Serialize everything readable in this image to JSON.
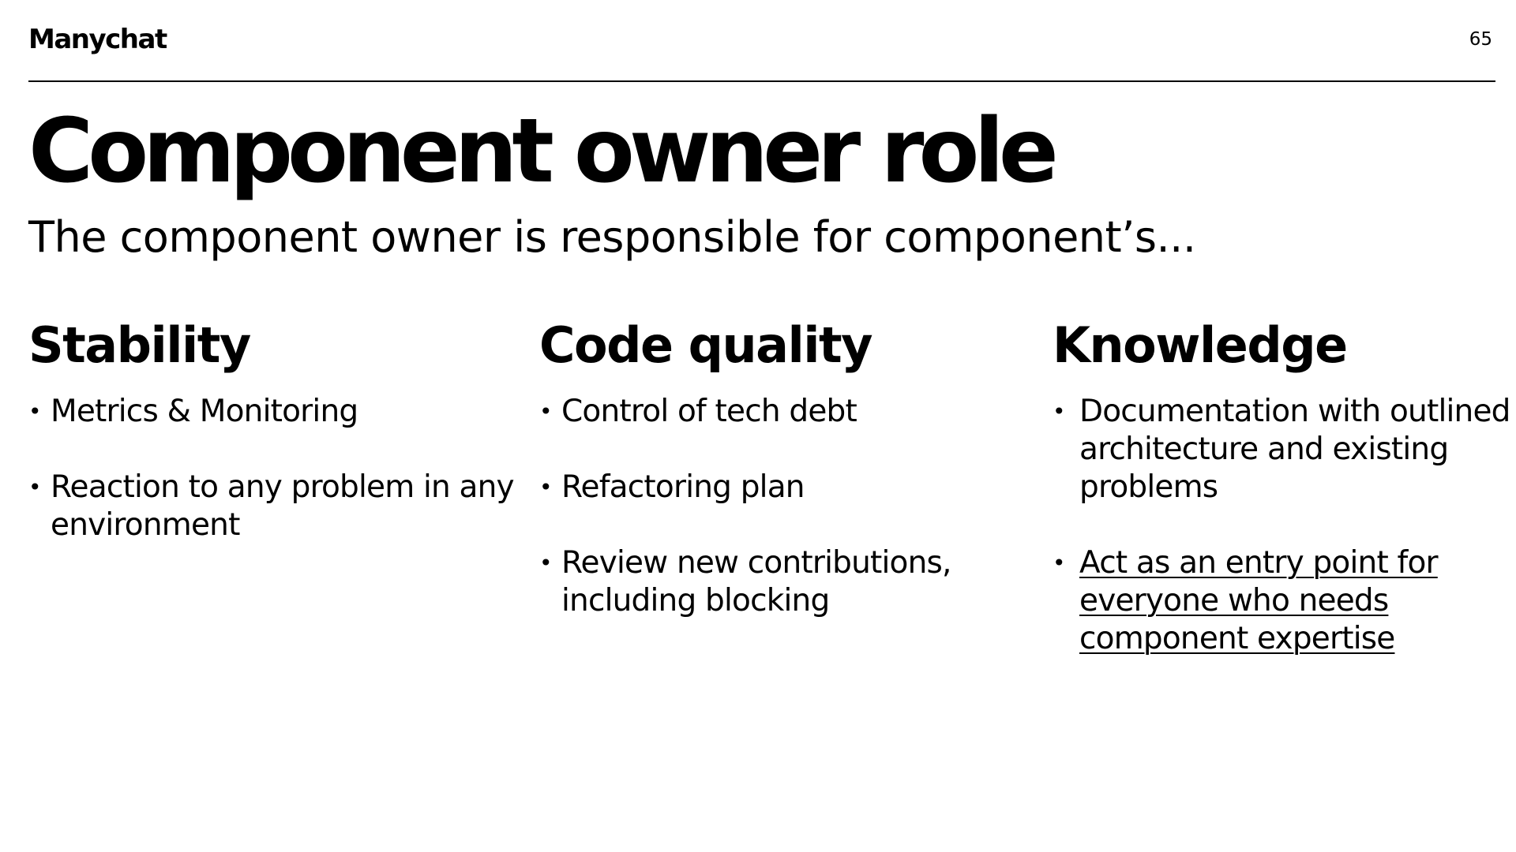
{
  "header": {
    "logo_text": "Manychat",
    "page_number": "65"
  },
  "title": "Component owner role",
  "subtitle": "The component owner is responsible for component’s...",
  "bullet_symbol": "•",
  "columns": [
    {
      "heading": "Stability",
      "items": [
        {
          "text": "Metrics & Monitoring"
        },
        {
          "text": "Reaction to any problem in any environment"
        }
      ]
    },
    {
      "heading": "Code quality",
      "items": [
        {
          "text": "Control of tech debt"
        },
        {
          "text": "Refactoring plan"
        },
        {
          "text": "Review new contributions, including blocking"
        }
      ]
    },
    {
      "heading": "Knowledge",
      "items": [
        {
          "text": "Documentation with outlined architecture and existing problems"
        },
        {
          "text": "Act as an entry point for everyone who needs component expertise",
          "underlined": true
        }
      ]
    }
  ]
}
